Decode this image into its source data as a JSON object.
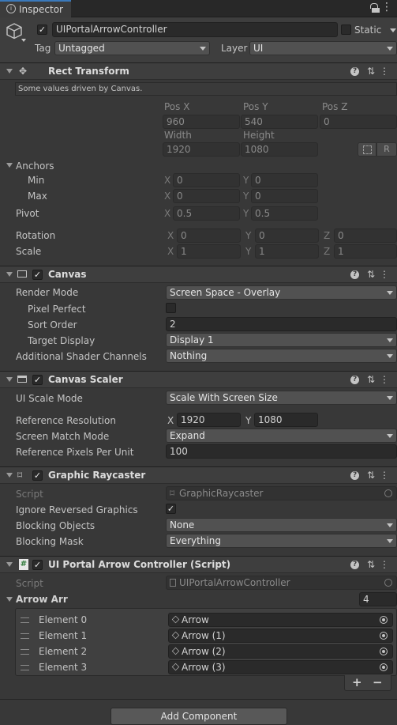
{
  "tab": {
    "title": "Inspector"
  },
  "object": {
    "name": "UIPortalArrowController",
    "static_label": "Static",
    "tag_label": "Tag",
    "tag_value": "Untagged",
    "layer_label": "Layer",
    "layer_value": "UI",
    "active": true
  },
  "rect_transform": {
    "title": "Rect Transform",
    "note": "Some values driven by Canvas.",
    "pos_x_label": "Pos X",
    "pos_y_label": "Pos Y",
    "pos_z_label": "Pos Z",
    "pos_x": "960",
    "pos_y": "540",
    "pos_z": "0",
    "width_label": "Width",
    "height_label": "Height",
    "width": "1920",
    "height": "1080",
    "r_button": "R",
    "anchors_label": "Anchors",
    "min_label": "Min",
    "max_label": "Max",
    "min_x": "0",
    "min_y": "0",
    "max_x": "0",
    "max_y": "0",
    "pivot_label": "Pivot",
    "pivot_x": "0.5",
    "pivot_y": "0.5",
    "rotation_label": "Rotation",
    "rot_x": "0",
    "rot_y": "0",
    "rot_z": "0",
    "scale_label": "Scale",
    "scale_x": "1",
    "scale_y": "1",
    "scale_z": "1",
    "axis_x": "X",
    "axis_y": "Y",
    "axis_z": "Z"
  },
  "canvas": {
    "title": "Canvas",
    "render_mode_label": "Render Mode",
    "render_mode": "Screen Space - Overlay",
    "pixel_perfect_label": "Pixel Perfect",
    "sort_order_label": "Sort Order",
    "sort_order": "2",
    "target_display_label": "Target Display",
    "target_display": "Display 1",
    "shader_channels_label": "Additional Shader Channels",
    "shader_channels": "Nothing"
  },
  "canvas_scaler": {
    "title": "Canvas Scaler",
    "ui_scale_mode_label": "UI Scale Mode",
    "ui_scale_mode": "Scale With Screen Size",
    "ref_res_label": "Reference Resolution",
    "ref_x": "1920",
    "ref_y": "1080",
    "match_mode_label": "Screen Match Mode",
    "match_mode": "Expand",
    "ppu_label": "Reference Pixels Per Unit",
    "ppu": "100"
  },
  "raycaster": {
    "title": "Graphic Raycaster",
    "script_label": "Script",
    "script": "GraphicRaycaster",
    "ignore_label": "Ignore Reversed Graphics",
    "blocking_objects_label": "Blocking Objects",
    "blocking_objects": "None",
    "blocking_mask_label": "Blocking Mask",
    "blocking_mask": "Everything"
  },
  "controller": {
    "title": "UI Portal Arrow Controller (Script)",
    "script_label": "Script",
    "script": "UIPortalArrowController",
    "array_label": "Arrow Arr",
    "array_size": "4",
    "elements": [
      {
        "label": "Element 0",
        "value": "Arrow"
      },
      {
        "label": "Element 1",
        "value": "Arrow (1)"
      },
      {
        "label": "Element 2",
        "value": "Arrow (2)"
      },
      {
        "label": "Element 3",
        "value": "Arrow (3)"
      }
    ],
    "add_btn": "+",
    "remove_btn": "−"
  },
  "add_component": "Add Component",
  "icons": [
    "inspector-icon",
    "lock-icon",
    "menu-icon",
    "cube-icon",
    "settings-icon",
    "help-icon",
    "presets-icon",
    "target-icon"
  ]
}
